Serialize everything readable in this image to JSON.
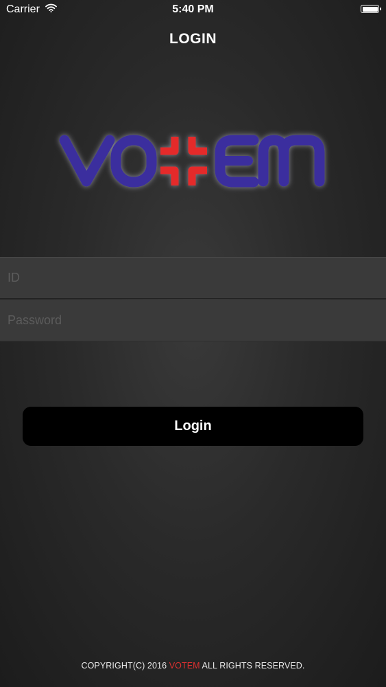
{
  "status_bar": {
    "carrier": "Carrier",
    "time": "5:40 PM",
    "wifi_icon": "wifi-icon",
    "battery_icon": "battery-full-icon"
  },
  "nav": {
    "title": "LOGIN"
  },
  "logo": {
    "text": "VOTEM",
    "colors": {
      "letters": "#3a2e9e",
      "cross": "#e52a2a"
    }
  },
  "form": {
    "id_placeholder": "ID",
    "id_value": "",
    "password_placeholder": "Password",
    "password_value": "",
    "login_label": "Login"
  },
  "footer": {
    "prefix": "COPYRIGHT(C) 2016 ",
    "brand": "VOTEM",
    "suffix": " ALL RIGHTS RESERVED.",
    "brand_color": "#e03030"
  }
}
